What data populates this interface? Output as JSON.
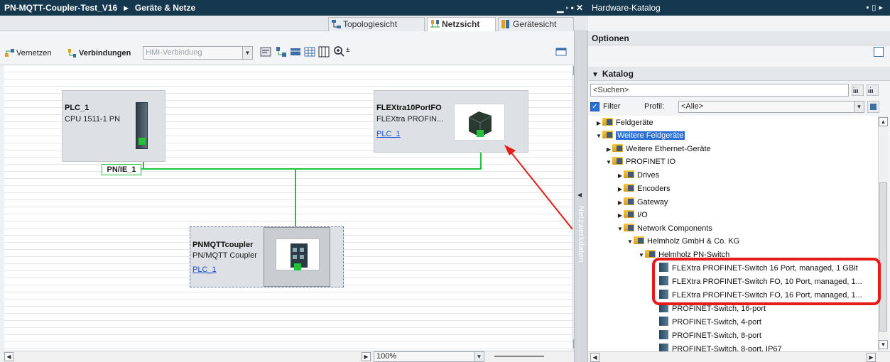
{
  "left_window": {
    "title": "PN-MQTT-Coupler-Test_V16",
    "breadcrumb_sep": "▸",
    "breadcrumb_item": "Geräte & Netze",
    "view_tabs": [
      {
        "label": "Topologiesicht",
        "icon": "topology-icon"
      },
      {
        "label": "Netzsicht",
        "icon": "network-view-icon"
      },
      {
        "label": "Gerätesicht",
        "icon": "device-view-icon"
      }
    ]
  },
  "toolbar": {
    "vernetzen": "Vernetzen",
    "verbindungen": "Verbindungen",
    "connection_type": "HMI-Verbindung",
    "zoom": "100%"
  },
  "devices": [
    {
      "name": "PLC_1",
      "type": "CPU 1511-1 PN",
      "link": ""
    },
    {
      "name": "FLEXtra10PortFO",
      "type": "FLEXtra PROFIN...",
      "link": "PLC_1"
    },
    {
      "name": "PNMQTTcoupler",
      "type": "PN/MQTT Coupler",
      "link": "PLC_1"
    }
  ],
  "network": {
    "label": "PN/IE_1",
    "color": "#22c33a"
  },
  "side_strip": {
    "label": "Netzwerkdaten"
  },
  "catalog": {
    "title": "Hardware-Katalog",
    "options_label": "Optionen",
    "section_label": "Katalog",
    "search_placeholder": "<Suchen>",
    "filter_label": "Filter",
    "profile_label": "Profil:",
    "profile_value": "<Alle>",
    "tree": [
      {
        "label": "Feldgeräte",
        "type": "folder",
        "expanded": false
      },
      {
        "label": "Weitere Feldgeräte",
        "type": "folder",
        "expanded": true,
        "selected": true
      },
      {
        "label": "Weitere Ethernet-Geräte",
        "type": "folder",
        "expanded": false
      },
      {
        "label": "PROFINET IO",
        "type": "folder",
        "expanded": true
      },
      {
        "label": "Drives",
        "type": "folder",
        "expanded": false
      },
      {
        "label": "Encoders",
        "type": "folder",
        "expanded": false
      },
      {
        "label": "Gateway",
        "type": "folder",
        "expanded": false
      },
      {
        "label": "I/O",
        "type": "folder",
        "expanded": false
      },
      {
        "label": "Network Components",
        "type": "folder",
        "expanded": true
      },
      {
        "label": "Helmholz GmbH & Co. KG",
        "type": "folder",
        "expanded": true
      },
      {
        "label": "Helmholz PN-Switch",
        "type": "folder",
        "expanded": true
      },
      {
        "label": "FLEXtra PROFINET-Switch 16 Port, managed, 1 GBit",
        "type": "device"
      },
      {
        "label": "FLEXtra PROFINET-Switch FO, 10 Port, managed, 1...",
        "type": "device"
      },
      {
        "label": "FLEXtra PROFINET-Switch FO, 16 Port, managed, 1...",
        "type": "device"
      },
      {
        "label": "PROFINET-Switch, 16-port",
        "type": "device"
      },
      {
        "label": "PROFINET-Switch, 4-port",
        "type": "device"
      },
      {
        "label": "PROFINET-Switch, 8-port",
        "type": "device"
      },
      {
        "label": "PROFINET-Switch, 8-port, IP67",
        "type": "device"
      }
    ]
  },
  "annotation_color": "#e41b17"
}
